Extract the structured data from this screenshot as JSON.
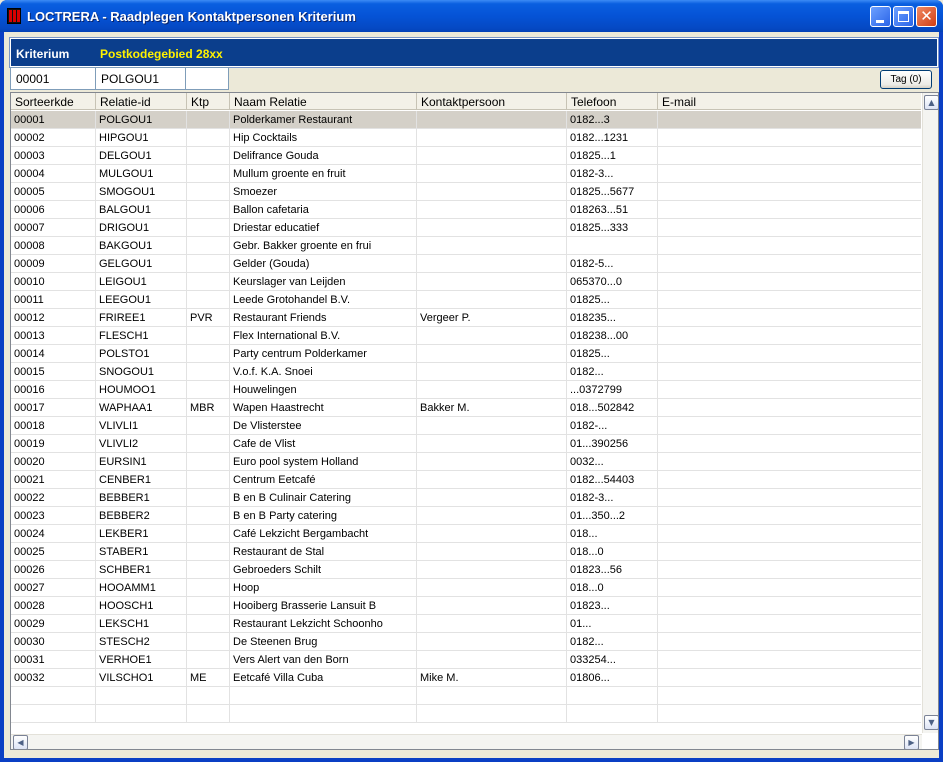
{
  "window": {
    "title": "LOCTRERA - Raadplegen Kontaktpersonen Kriterium",
    "accent": "#0553D6"
  },
  "criterium": {
    "label": "Kriterium",
    "value": "Postkodegebied 28xx",
    "value_color": "#FFF200"
  },
  "filters": {
    "sorteerkde": "00001",
    "relatie_id": "POLGOU1",
    "ktp": ""
  },
  "tag_button": {
    "label": "Tag (0)"
  },
  "table": {
    "columns": [
      "Sorteerkde",
      "Relatie-id",
      "Ktp",
      "Naam Relatie",
      "Kontaktpersoon",
      "Telefoon",
      "E-mail"
    ],
    "rows": [
      {
        "sk": "00001",
        "rid": "POLGOU1",
        "ktp": "",
        "naam": "Polderkamer Restaurant",
        "kp": "",
        "tel": "0182...3",
        "email": "",
        "selected": true
      },
      {
        "sk": "00002",
        "rid": "HIPGOU1",
        "ktp": "",
        "naam": "Hip Cocktails",
        "kp": "",
        "tel": "0182...1231",
        "email": ""
      },
      {
        "sk": "00003",
        "rid": "DELGOU1",
        "ktp": "",
        "naam": "Delifrance Gouda",
        "kp": "",
        "tel": "01825...1",
        "email": ""
      },
      {
        "sk": "00004",
        "rid": "MULGOU1",
        "ktp": "",
        "naam": "Mullum groente en fruit",
        "kp": "",
        "tel": "0182-3...",
        "email": ""
      },
      {
        "sk": "00005",
        "rid": "SMOGOU1",
        "ktp": "",
        "naam": "Smoezer",
        "kp": "",
        "tel": "01825...5677",
        "email": ""
      },
      {
        "sk": "00006",
        "rid": "BALGOU1",
        "ktp": "",
        "naam": "Ballon cafetaria",
        "kp": "",
        "tel": "018263...51",
        "email": ""
      },
      {
        "sk": "00007",
        "rid": "DRIGOU1",
        "ktp": "",
        "naam": "Driestar educatief",
        "kp": "",
        "tel": "01825...333",
        "email": ""
      },
      {
        "sk": "00008",
        "rid": "BAKGOU1",
        "ktp": "",
        "naam": "Gebr. Bakker groente en frui",
        "kp": "",
        "tel": "",
        "email": ""
      },
      {
        "sk": "00009",
        "rid": "GELGOU1",
        "ktp": "",
        "naam": "Gelder (Gouda)",
        "kp": "",
        "tel": "0182-5...",
        "email": ""
      },
      {
        "sk": "00010",
        "rid": "LEIGOU1",
        "ktp": "",
        "naam": "Keurslager van Leijden",
        "kp": "",
        "tel": "065370...0",
        "email": ""
      },
      {
        "sk": "00011",
        "rid": "LEEGOU1",
        "ktp": "",
        "naam": "Leede Grotohandel B.V.",
        "kp": "",
        "tel": "01825...",
        "email": ""
      },
      {
        "sk": "00012",
        "rid": "FRIREE1",
        "ktp": "PVR",
        "naam": "Restaurant Friends",
        "kp": "Vergeer P.",
        "tel": "018235...",
        "email": ""
      },
      {
        "sk": "00013",
        "rid": "FLESCH1",
        "ktp": "",
        "naam": "Flex International B.V.",
        "kp": "",
        "tel": "018238...00",
        "email": ""
      },
      {
        "sk": "00014",
        "rid": "POLSTO1",
        "ktp": "",
        "naam": "Party centrum Polderkamer",
        "kp": "",
        "tel": "01825...",
        "email": ""
      },
      {
        "sk": "00015",
        "rid": "SNOGOU1",
        "ktp": "",
        "naam": "V.o.f. K.A. Snoei",
        "kp": "",
        "tel": "0182...",
        "email": ""
      },
      {
        "sk": "00016",
        "rid": "HOUMOO1",
        "ktp": "",
        "naam": "Houwelingen",
        "kp": "",
        "tel": "...0372799",
        "email": ""
      },
      {
        "sk": "00017",
        "rid": "WAPHAA1",
        "ktp": "MBR",
        "naam": "Wapen Haastrecht",
        "kp": "Bakker M.",
        "tel": "018...502842",
        "email": ""
      },
      {
        "sk": "00018",
        "rid": "VLIVLI1",
        "ktp": "",
        "naam": "De Vlisterstee",
        "kp": "",
        "tel": "0182-...",
        "email": ""
      },
      {
        "sk": "00019",
        "rid": "VLIVLI2",
        "ktp": "",
        "naam": "Cafe de Vlist",
        "kp": "",
        "tel": "01...390256",
        "email": ""
      },
      {
        "sk": "00020",
        "rid": "EURSIN1",
        "ktp": "",
        "naam": "Euro pool system Holland",
        "kp": "",
        "tel": "0032...",
        "email": ""
      },
      {
        "sk": "00021",
        "rid": "CENBER1",
        "ktp": "",
        "naam": "Centrum Eetcafé",
        "kp": "",
        "tel": "0182...54403",
        "email": ""
      },
      {
        "sk": "00022",
        "rid": "BEBBER1",
        "ktp": "",
        "naam": "B en B Culinair Catering",
        "kp": "",
        "tel": "0182-3...",
        "email": ""
      },
      {
        "sk": "00023",
        "rid": "BEBBER2",
        "ktp": "",
        "naam": "B en B Party catering",
        "kp": "",
        "tel": "01...350...2",
        "email": ""
      },
      {
        "sk": "00024",
        "rid": "LEKBER1",
        "ktp": "",
        "naam": "Café Lekzicht Bergambacht",
        "kp": "",
        "tel": "018...",
        "email": ""
      },
      {
        "sk": "00025",
        "rid": "STABER1",
        "ktp": "",
        "naam": "Restaurant de Stal",
        "kp": "",
        "tel": "018...0",
        "email": ""
      },
      {
        "sk": "00026",
        "rid": "SCHBER1",
        "ktp": "",
        "naam": "Gebroeders Schilt",
        "kp": "",
        "tel": "01823...56",
        "email": ""
      },
      {
        "sk": "00027",
        "rid": "HOOAMM1",
        "ktp": "",
        "naam": "Hoop",
        "kp": "",
        "tel": "018...0",
        "email": ""
      },
      {
        "sk": "00028",
        "rid": "HOOSCH1",
        "ktp": "",
        "naam": "Hooiberg Brasserie Lansuit B",
        "kp": "",
        "tel": "01823...",
        "email": ""
      },
      {
        "sk": "00029",
        "rid": "LEKSCH1",
        "ktp": "",
        "naam": "Restaurant Lekzicht Schoonho",
        "kp": "",
        "tel": "01...",
        "email": ""
      },
      {
        "sk": "00030",
        "rid": "STESCH2",
        "ktp": "",
        "naam": "De Steenen Brug",
        "kp": "",
        "tel": "0182...",
        "email": ""
      },
      {
        "sk": "00031",
        "rid": "VERHOE1",
        "ktp": "",
        "naam": "Vers Alert van den Born",
        "kp": "",
        "tel": "033254...",
        "email": ""
      },
      {
        "sk": "00032",
        "rid": "VILSCHO1",
        "ktp": "ME",
        "naam": "Eetcafé Villa Cuba",
        "kp": "Mike M.",
        "tel": "01806...",
        "email": ""
      }
    ],
    "empty_rows": 2
  }
}
